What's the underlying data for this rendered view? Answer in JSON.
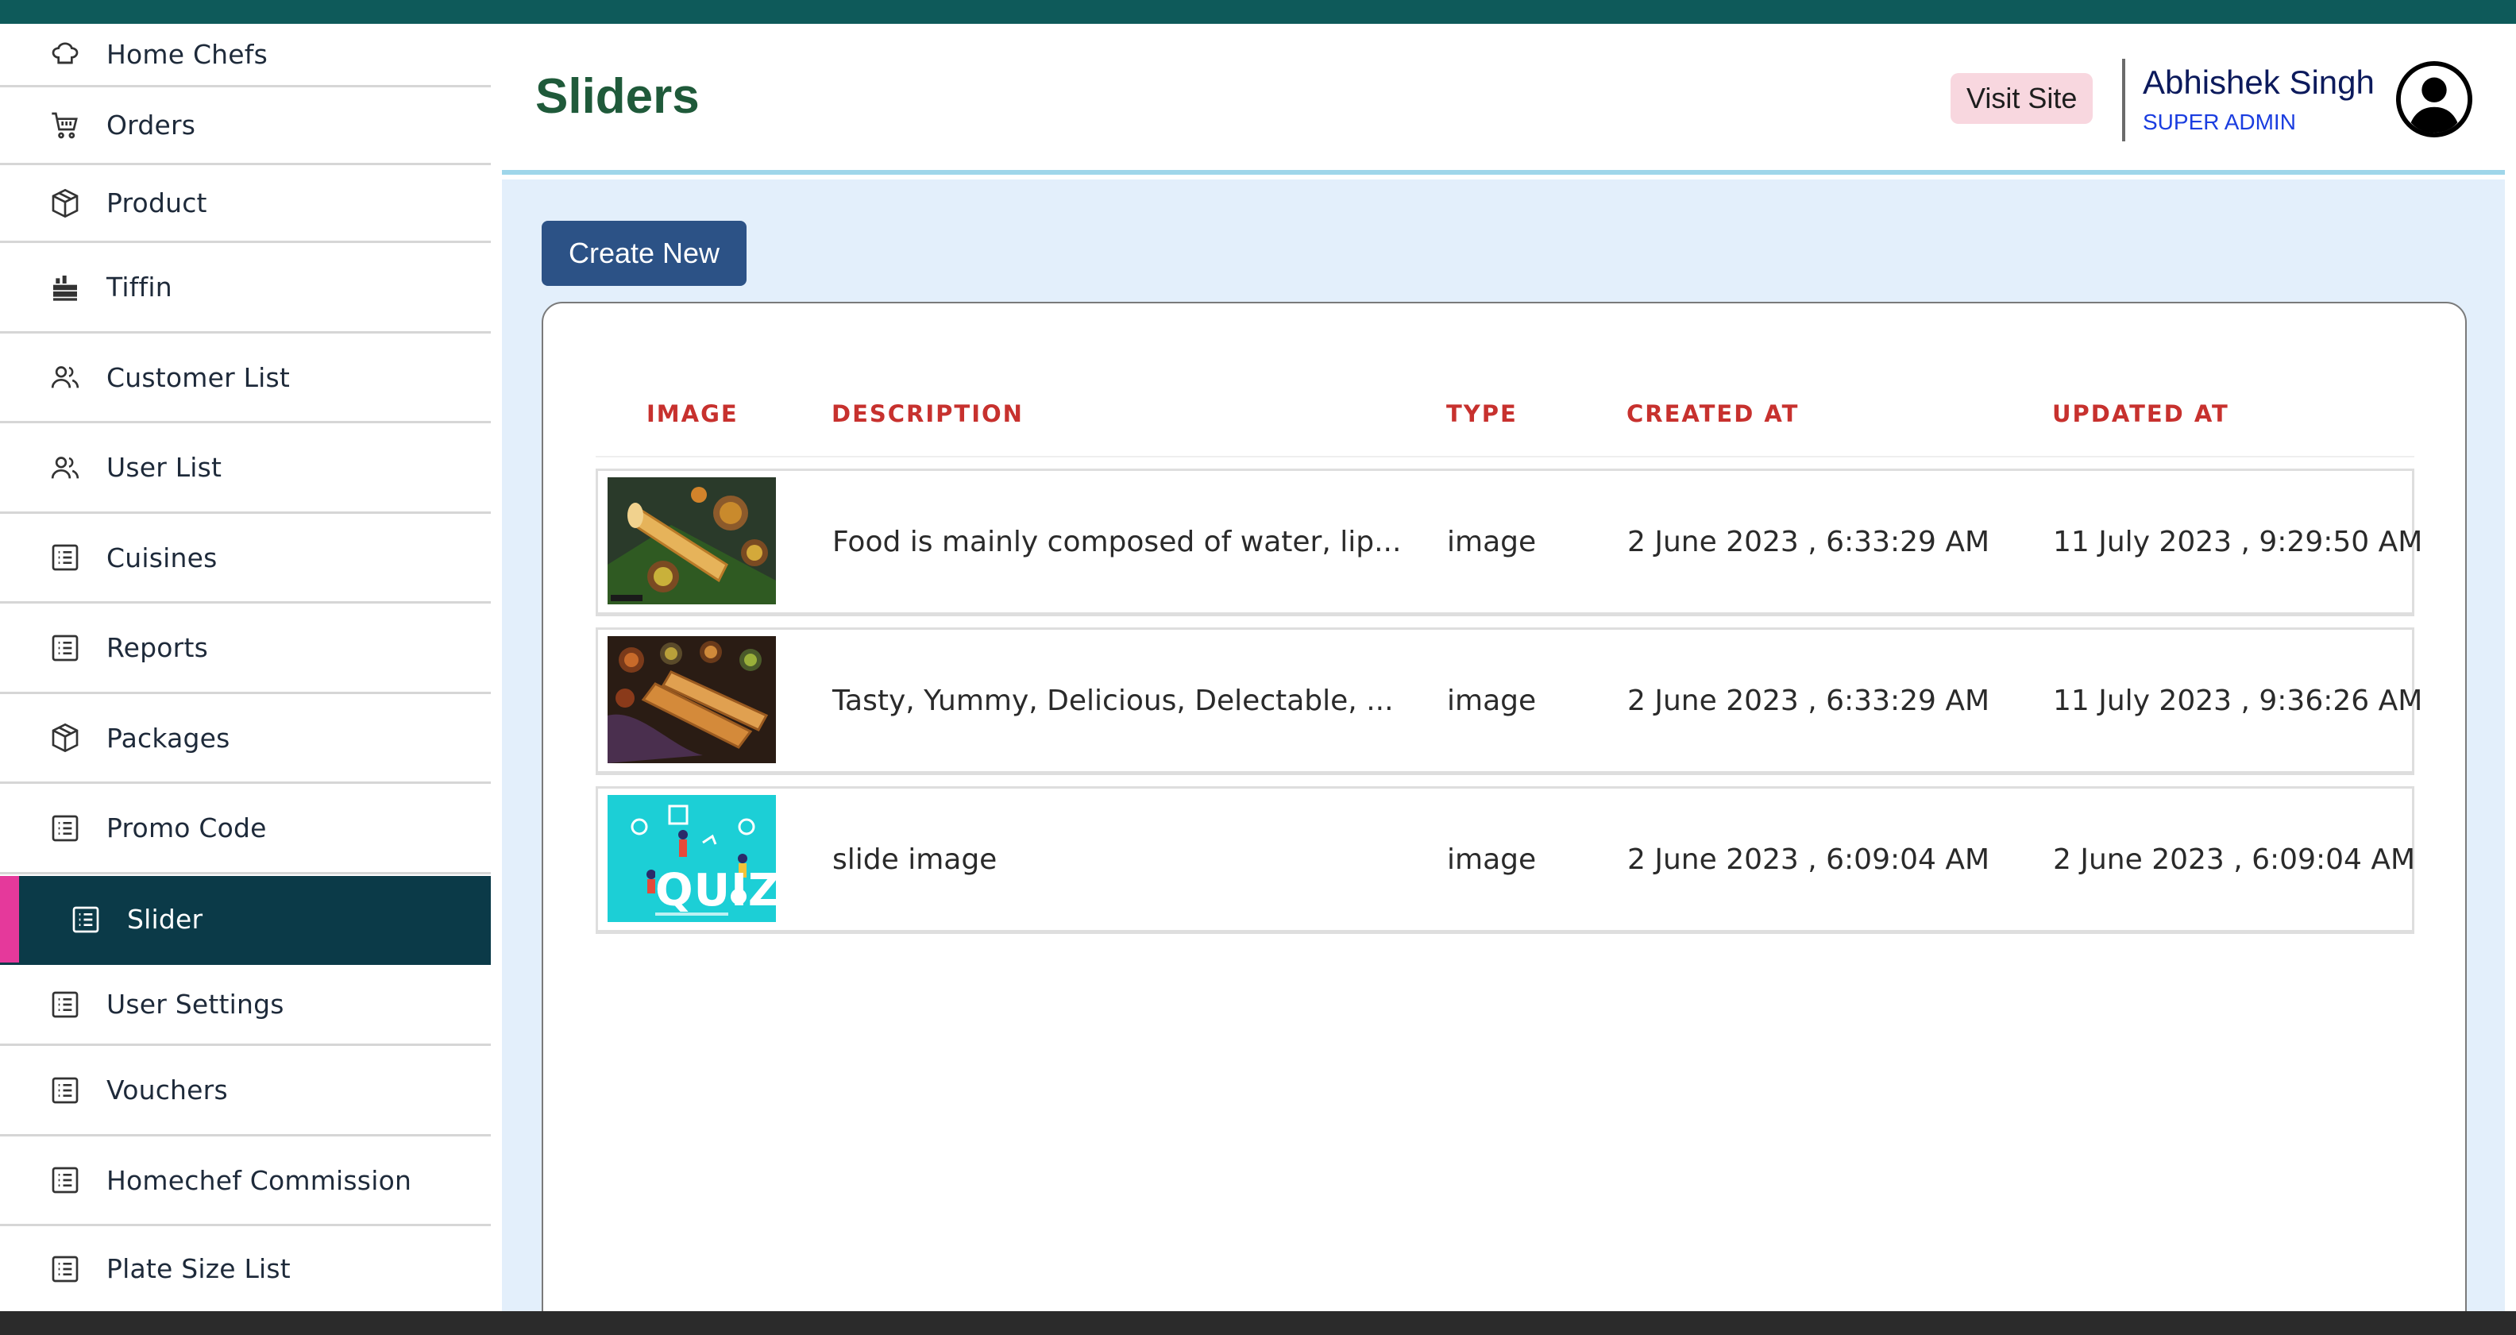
{
  "sidebar": {
    "items": [
      {
        "label": "Home Chefs",
        "icon": "chef-hat-icon"
      },
      {
        "label": "Orders",
        "icon": "cart-icon"
      },
      {
        "label": "Product",
        "icon": "box-icon"
      },
      {
        "label": "Tiffin",
        "icon": "tiffin-icon"
      },
      {
        "label": "Customer List",
        "icon": "users-icon"
      },
      {
        "label": "User List",
        "icon": "users-icon"
      },
      {
        "label": "Cuisines",
        "icon": "list-icon"
      },
      {
        "label": "Reports",
        "icon": "list-icon"
      },
      {
        "label": "Packages",
        "icon": "box-icon"
      },
      {
        "label": "Promo Code",
        "icon": "list-icon"
      },
      {
        "label": "Slider",
        "icon": "list-icon",
        "active": true
      },
      {
        "label": "User Settings",
        "icon": "list-icon"
      },
      {
        "label": "Vouchers",
        "icon": "list-icon"
      },
      {
        "label": "Homechef Commission",
        "icon": "list-icon"
      },
      {
        "label": "Plate Size List",
        "icon": "list-icon"
      }
    ]
  },
  "header": {
    "title": "Sliders",
    "visit_site": "Visit Site",
    "user_name": "Abhishek Singh",
    "user_role": "SUPER ADMIN"
  },
  "main": {
    "create_button": "Create New",
    "table": {
      "columns": [
        "IMAGE",
        "DESCRIPTION",
        "TYPE",
        "CREATED AT",
        "UPDATED AT"
      ],
      "rows": [
        {
          "image": "dosa-thali-image",
          "description": "Food is mainly composed of water, lip...",
          "type": "image",
          "created_at": "2 June 2023 , 6:33:29 AM",
          "updated_at": "11 July 2023 , 9:29:50 AM"
        },
        {
          "image": "dosa-platter-image",
          "description": "Tasty, Yummy, Delicious, Delectable, ...",
          "type": "image",
          "created_at": "2 June 2023 , 6:33:29 AM",
          "updated_at": "11 July 2023 , 9:36:26 AM"
        },
        {
          "image": "quiz-banner-image",
          "description": "slide image",
          "type": "image",
          "created_at": "2 June 2023 , 6:09:04 AM",
          "updated_at": "2 June 2023 , 6:09:04 AM"
        }
      ]
    }
  },
  "colors": {
    "active_sidebar": "#0b3a48",
    "active_accent": "#e5399b",
    "button_primary": "#2c5286",
    "header_text": "#c7312e",
    "title_green": "#1f5a3a",
    "main_bg": "#e3effb"
  }
}
